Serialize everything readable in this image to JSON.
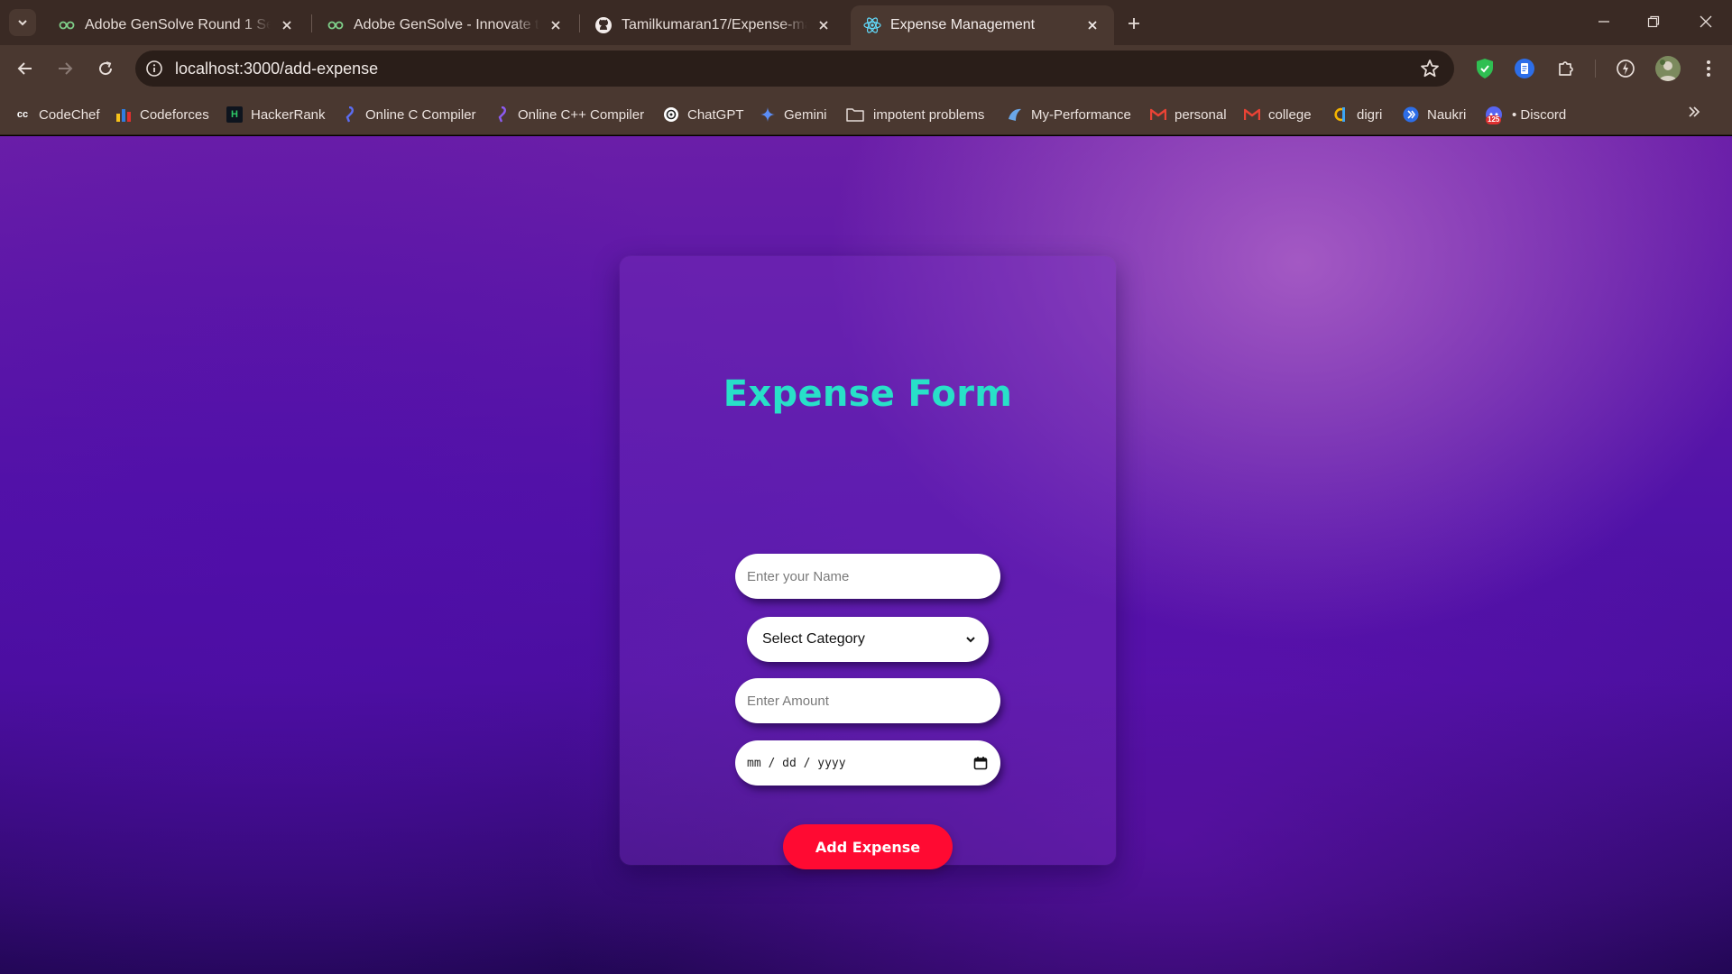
{
  "browser": {
    "tabs": [
      {
        "title": "Adobe GenSolve Round 1 Set C",
        "favicon": "adobe-gensolve-icon",
        "active": false
      },
      {
        "title": "Adobe GenSolve - Innovate to b",
        "favicon": "adobe-gensolve-icon",
        "active": false
      },
      {
        "title": "Tamilkumaran17/Expense-mana",
        "favicon": "github-icon",
        "active": false
      },
      {
        "title": "Expense Management",
        "favicon": "react-icon",
        "active": true
      }
    ],
    "url": "localhost:3000/add-expense",
    "bookmarks": [
      {
        "label": "CodeChef",
        "icon": "codechef-icon"
      },
      {
        "label": "Codeforces",
        "icon": "codeforces-icon"
      },
      {
        "label": "HackerRank",
        "icon": "hackerrank-icon"
      },
      {
        "label": "Online C Compiler",
        "icon": "compiler-icon"
      },
      {
        "label": "Online C++ Compiler",
        "icon": "compiler-icon"
      },
      {
        "label": "ChatGPT",
        "icon": "chatgpt-icon"
      },
      {
        "label": "Gemini",
        "icon": "gemini-icon"
      },
      {
        "label": "impotent problems",
        "icon": "folder-icon"
      },
      {
        "label": "My-Performance",
        "icon": "performance-icon"
      },
      {
        "label": "personal",
        "icon": "gmail-icon"
      },
      {
        "label": "college",
        "icon": "gmail-icon"
      },
      {
        "label": "digri",
        "icon": "digri-icon"
      },
      {
        "label": "Naukri",
        "icon": "naukri-icon"
      },
      {
        "label": "• Discord",
        "icon": "discord-icon",
        "badge": "125"
      }
    ]
  },
  "form": {
    "title": "Expense Form",
    "name_placeholder": "Enter your Name",
    "category_selected": "Select Category",
    "amount_placeholder": "Enter Amount",
    "date_placeholder": "mm / dd / yyyy",
    "submit_label": "Add Expense"
  },
  "colors": {
    "title": "#28e0c8",
    "button": "#ff0a32",
    "page_top": "#6a1ea8",
    "page_bottom": "#1f0650"
  }
}
